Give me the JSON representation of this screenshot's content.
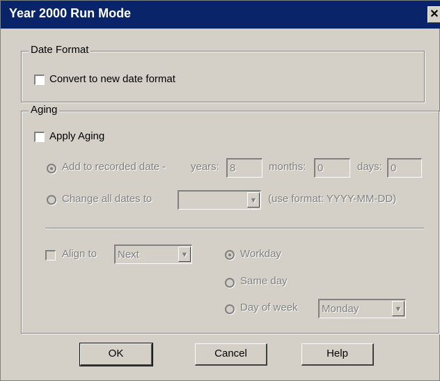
{
  "window": {
    "title": "Year 2000 Run Mode",
    "close_glyph": "✕"
  },
  "date_format": {
    "legend": "Date Format",
    "convert_label": "Convert to new date format",
    "convert_checked": false
  },
  "aging": {
    "legend": "Aging",
    "apply_label": "Apply Aging",
    "apply_checked": false,
    "add_label": "Add to recorded date -",
    "years_label": "years:",
    "years_value": "8",
    "months_label": "months:",
    "months_value": "0",
    "days_label": "days:",
    "days_value": "0",
    "change_label": "Change all dates to",
    "change_value": "",
    "format_hint": "(use format: YYYY-MM-DD)",
    "align_label": "Align to",
    "align_value": "Next",
    "workday_label": "Workday",
    "sameday_label": "Same day",
    "dayofweek_label": "Day of week",
    "dayofweek_value": "Monday"
  },
  "buttons": {
    "ok": "OK",
    "cancel": "Cancel",
    "help": "Help"
  },
  "colors": {
    "titlebar": "#0a246a",
    "face": "#d4d0c8",
    "disabled_text": "#808080"
  }
}
